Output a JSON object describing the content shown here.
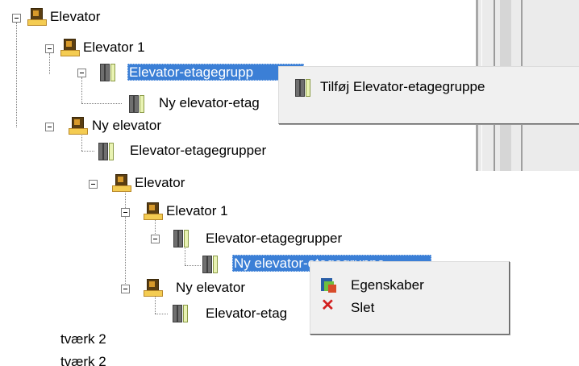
{
  "top_tree": {
    "root_label": "Elevator",
    "elevator1_label": "Elevator 1",
    "group_selected_label": "Elevator-etagegrupp",
    "new_group_label": "Ny elevator-etag",
    "new_elevator_label": "Ny elevator",
    "new_elevator_group_label": "Elevator-etagegrupper"
  },
  "top_menu": {
    "add_label": "Tilføj Elevator-etagegruppe",
    "add_icon": "floor-group-icon"
  },
  "bottom_tree": {
    "root_label": "Elevator",
    "elevator1_label": "Elevator 1",
    "groups_label": "Elevator-etagegrupper",
    "selected_label": "Ny elevator-etagegruppe",
    "new_elevator_label": "Ny elevator",
    "new_elevator_group_label": "Elevator-etag",
    "extra1_label": "tværk 2",
    "extra2_label": "tværk 2"
  },
  "bottom_menu": {
    "properties_label": "Egenskaber",
    "delete_label": "Slet",
    "properties_icon": "properties-icon",
    "delete_icon": "delete-x-icon"
  },
  "colors": {
    "selection": "#3b7fd6",
    "menu_bg": "#f0f0f0",
    "delete_red": "#d21f1f"
  }
}
